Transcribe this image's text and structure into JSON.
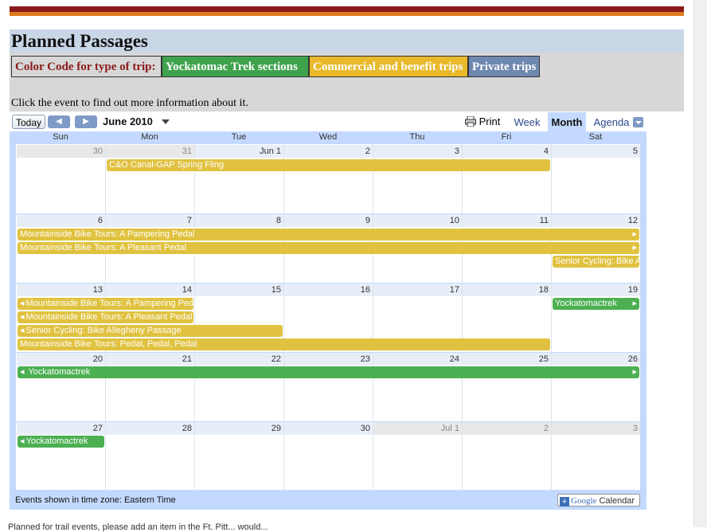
{
  "page": {
    "title": "Planned Passages",
    "instruction": "Click the event to find out more information about it.",
    "legend": {
      "label": "Color Code for type of trip:",
      "items": [
        {
          "label": "Yockatomac Trek sections",
          "color": "#3fa34d"
        },
        {
          "label": "Commercial and benefit trips",
          "color": "#e8b92b"
        },
        {
          "label": "Private trips",
          "color": "#6f88b0"
        }
      ]
    },
    "stripe_colors": [
      "#8b1a1a",
      "#e07a1f"
    ]
  },
  "calendar": {
    "toolbar": {
      "today": "Today",
      "prev_icon": "left-arrow-icon",
      "next_icon": "right-arrow-icon",
      "current_month": "June 2010",
      "print": "Print",
      "tabs": [
        "Week",
        "Month",
        "Agenda"
      ],
      "active_tab": "Month"
    },
    "weekdays": [
      "Sun",
      "Mon",
      "Tue",
      "Wed",
      "Thu",
      "Fri",
      "Sat"
    ],
    "weeks": [
      [
        "30",
        "31",
        "Jun 1",
        "2",
        "3",
        "4",
        "5"
      ],
      [
        "6",
        "7",
        "8",
        "9",
        "10",
        "11",
        "12"
      ],
      [
        "13",
        "14",
        "15",
        "16",
        "17",
        "18",
        "19"
      ],
      [
        "20",
        "21",
        "22",
        "23",
        "24",
        "25",
        "26"
      ],
      [
        "27",
        "28",
        "29",
        "30",
        "Jul 1",
        "2",
        "3"
      ]
    ],
    "events": {
      "canal_fling": "C&O Canal-GAP Spring Fling",
      "pampering": "Mountainside Bike Tours: A Pampering Pedal",
      "pleasant": "Mountainside Bike Tours: A Pleasant Pedal",
      "senior_start": "Senior Cycling: Bike Allegheny Passage",
      "pampering_cont": "Mountainside Bike Tours: A Pampering Pedal",
      "pleasant_cont": "Mountainside Bike Tours: A Pleasant Pedal",
      "senior_cont": "Senior Cycling: Bike Allegheny Passage",
      "pedal_pedal": "Mountainside Bike Tours: Pedal, Pedal, Pedal",
      "yock_19": "Yockatomactrek",
      "yock_week4": "Yockatomactrek",
      "yock_27": "Yockatomactrek"
    },
    "footer": {
      "timezone_note": "Events shown in time zone: Eastern Time",
      "gcal_google": "Google",
      "gcal_label": "Calendar"
    }
  },
  "cut_text": "Planned for trail events, please add an item in the Ft. Pitt... would..."
}
